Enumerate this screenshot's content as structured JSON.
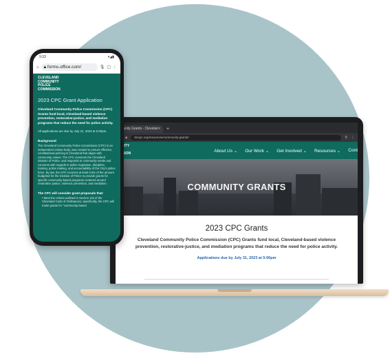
{
  "laptop": {
    "tab_title": "munity Grants - Clevelan",
    "tab_close": "×",
    "new_tab": "+",
    "url": "clecpc.org/resources/community-grants/",
    "logo_lines": [
      "MUNITY",
      "LICE",
      "MISSION"
    ],
    "menu": [
      "About Us ⌄",
      "Our Work ⌄",
      "Get Involved ⌄",
      "Resources ⌄",
      "Cont"
    ],
    "hero_title": "COMMUNITY GRANTS",
    "heading": "2023 CPC Grants",
    "description": "Cleveland Community Police Commission (CPC) Grants fund local, Cleveland-based violence prevention, restorative-justice, and mediation programs that reduce the need for police activity.",
    "applications_due": "Applications due by July 31, 2023 at 5:00pm"
  },
  "phone": {
    "time": "9:33",
    "status_icons": "▾◢▮",
    "url": "forms.office.com/",
    "logo_lines": [
      "CLEVELAND",
      "COMMUNITY",
      "POLICE",
      "COMMISSION"
    ],
    "heading": "2023 CPC Grant Application",
    "intro": "Cleveland Community Police Commission (CPC) Grants fund local, Cleveland-based violence prevention, restorative-justice, and mediation programs that reduce the need for police activity.",
    "due_note": "All applications are due by July 31, 2023 at 5:00pm.",
    "background_title": "Background",
    "background_text": "The Cleveland Community Police Commission (CPC) is an independent civilian body, was created to ensure effective, constitutional policing in Cleveland that aligns with community values. The CPC oversees the Cleveland Division of Police, and responds to community needs and concerns with regards to police regulation, discipline, training, police making, and accountability of the City's police force. By law, the CPC receives at least 0.5% of the amount budgeted for the Division of Police to provide grants for specific community-based programs centered around restorative justice, violence prevention, and mediation.",
    "consider_title": "The CPC will consider grant proposals that:",
    "bullet": "• Meet the criteria outlined in Section 115 of the Cleveland Code of Ordinances, specifically, the CPC will make grants for \"community-based"
  }
}
